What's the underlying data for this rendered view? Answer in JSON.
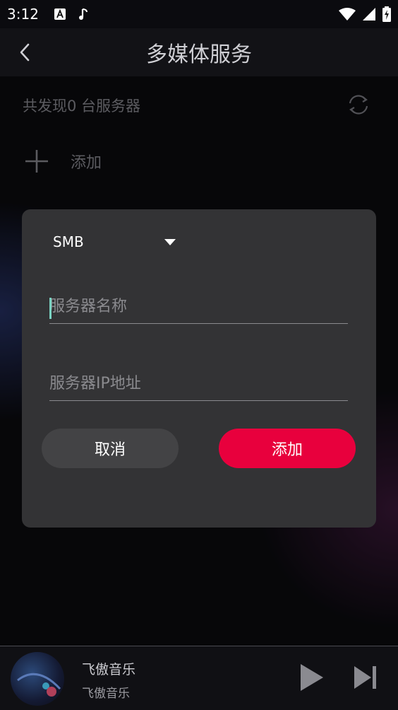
{
  "status_bar": {
    "time": "3:12",
    "icons": [
      "a-notification-icon",
      "music-note-icon",
      "wifi-icon",
      "signal-icon",
      "battery-charging-icon"
    ]
  },
  "header": {
    "title": "多媒体服务"
  },
  "server_list": {
    "found_text": "共发现0 台服务器",
    "add_label": "添加"
  },
  "dialog": {
    "protocol": "SMB",
    "name_placeholder": "服务器名称",
    "ip_placeholder": "服务器IP地址",
    "cancel_label": "取消",
    "confirm_label": "添加"
  },
  "player": {
    "title": "飞傲音乐",
    "artist": "飞傲音乐"
  },
  "colors": {
    "accent": "#e8003d",
    "dialog_bg": "#333335",
    "caret": "#7ad3c2"
  }
}
